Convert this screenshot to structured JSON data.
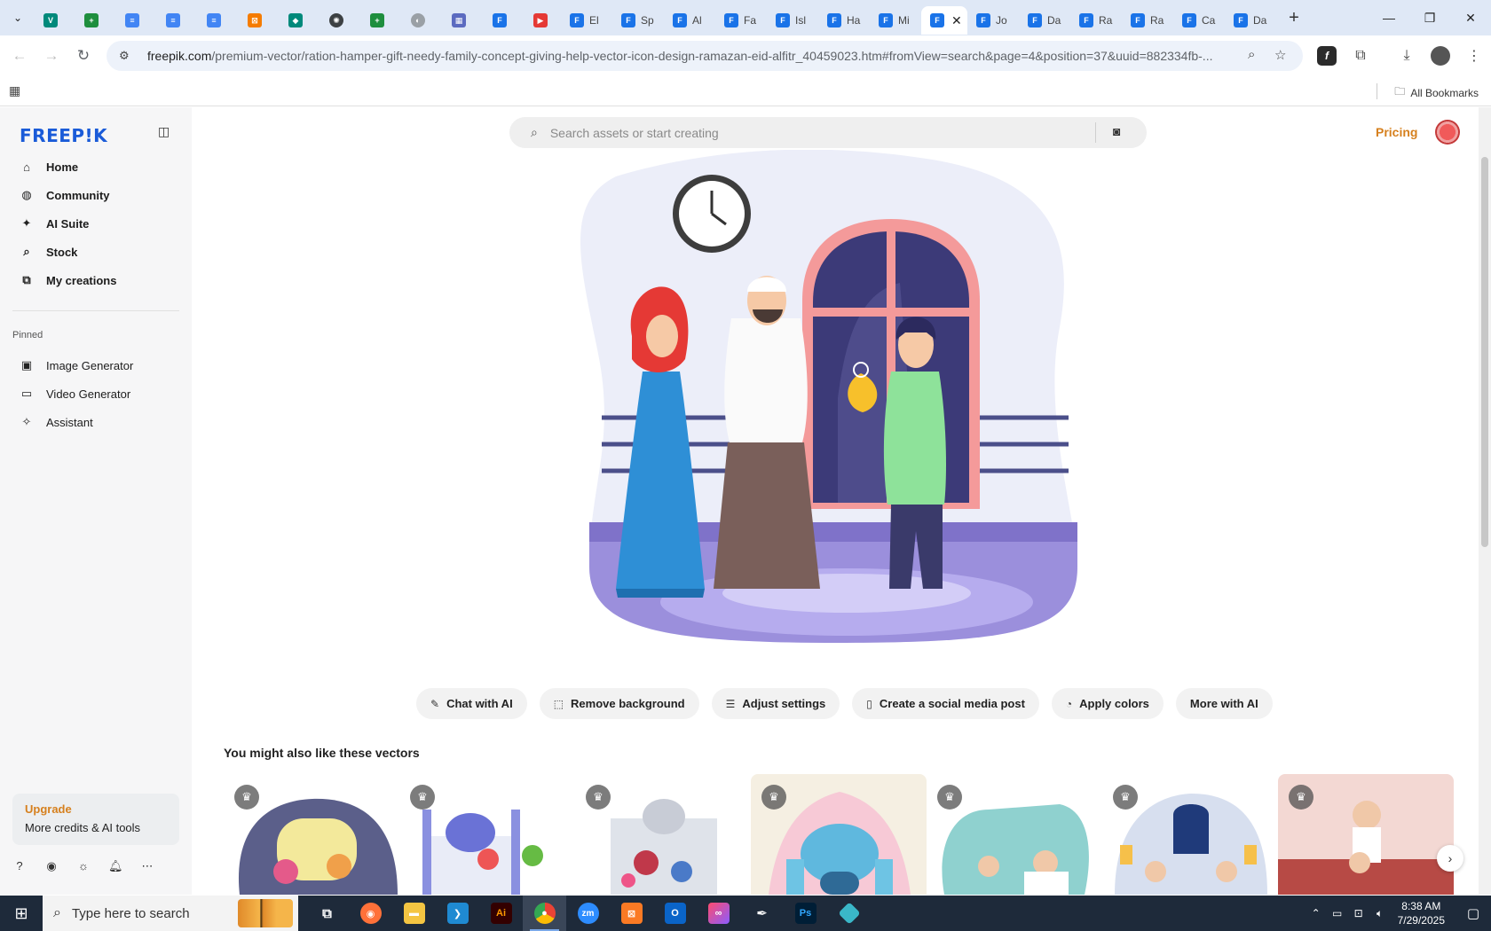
{
  "browser": {
    "tabs": [
      {
        "icon": "chevron-down-icon",
        "pinned": true
      },
      {
        "icon": "vpn-icon",
        "pinned": true
      },
      {
        "icon": "sheets-icon",
        "pinned": true
      },
      {
        "icon": "docs-icon",
        "pinned": true
      },
      {
        "icon": "docs-icon",
        "pinned": true
      },
      {
        "icon": "docs-icon",
        "pinned": true
      },
      {
        "icon": "xampp-icon",
        "pinned": true
      },
      {
        "icon": "tech-icon",
        "pinned": true
      },
      {
        "icon": "openai-icon",
        "pinned": true
      },
      {
        "icon": "sheets-icon",
        "pinned": true
      },
      {
        "icon": "globe-icon",
        "pinned": true
      },
      {
        "icon": "calculator-icon",
        "pinned": true
      },
      {
        "icon": "freepik-icon",
        "pinned": true
      },
      {
        "icon": "youtube-icon",
        "pinned": true
      },
      {
        "icon": "freepik-icon",
        "title": "El"
      },
      {
        "icon": "freepik-icon",
        "title": "Sp"
      },
      {
        "icon": "freepik-icon",
        "title": "Al"
      },
      {
        "icon": "freepik-icon",
        "title": "Fa"
      },
      {
        "icon": "freepik-icon",
        "title": "Isl"
      },
      {
        "icon": "freepik-icon",
        "title": "Ha"
      },
      {
        "icon": "freepik-icon",
        "title": "Mi"
      },
      {
        "icon": "freepik-icon",
        "active": true
      },
      {
        "icon": "freepik-icon",
        "title": "Jo"
      },
      {
        "icon": "freepik-icon",
        "title": "Da"
      },
      {
        "icon": "freepik-icon",
        "title": "Ra"
      },
      {
        "icon": "freepik-icon",
        "title": "Ra"
      },
      {
        "icon": "freepik-icon",
        "title": "Ca"
      },
      {
        "icon": "freepik-icon",
        "title": "Da"
      }
    ],
    "url_host": "freepik.com",
    "url_path": "/premium-vector/ration-hamper-gift-needy-family-concept-giving-help-vector-icon-design-ramazan-eid-alfitr_40459023.htm#fromView=search&page=4&position=37&uuid=882334fb-...",
    "all_bookmarks": "All Bookmarks"
  },
  "sidebar": {
    "logo": "FREEP!K",
    "nav": [
      {
        "icon": "home-icon",
        "label": "Home"
      },
      {
        "icon": "globe-icon",
        "label": "Community"
      },
      {
        "icon": "sparkle-icon",
        "label": "AI Suite"
      },
      {
        "icon": "search-icon",
        "label": "Stock"
      },
      {
        "icon": "stack-icon",
        "label": "My creations"
      }
    ],
    "pinned_label": "Pinned",
    "pinned": [
      {
        "icon": "image-icon",
        "label": "Image Generator"
      },
      {
        "icon": "video-icon",
        "label": "Video Generator"
      },
      {
        "icon": "chat-sparkle-icon",
        "label": "Assistant"
      }
    ],
    "upgrade": {
      "title": "Upgrade",
      "subtitle": "More credits & AI tools"
    }
  },
  "header": {
    "search_placeholder": "Search assets or start creating",
    "pricing": "Pricing"
  },
  "ai_actions": [
    {
      "icon": "chat-edit-icon",
      "label": "Chat with AI"
    },
    {
      "icon": "remove-bg-icon",
      "label": "Remove background"
    },
    {
      "icon": "sliders-icon",
      "label": "Adjust settings"
    },
    {
      "icon": "phone-icon",
      "label": "Create a social media post"
    },
    {
      "icon": "palette-icon",
      "label": "Apply colors"
    },
    {
      "icon": "",
      "label": "More with AI"
    }
  ],
  "related": {
    "title": "You might also like these vectors",
    "items": [
      "mosque-family",
      "mosque-donation",
      "mosque-charity",
      "pink-mosque",
      "arch-greeting",
      "lantern-window",
      "quran-reading"
    ]
  },
  "taskbar": {
    "search_text": "Type here to search",
    "time": "8:38 AM",
    "date": "7/29/2025"
  },
  "colors": {
    "brand_blue": "#1a5bd8",
    "pricing_orange": "#d6801e",
    "sidebar_bg": "#f6f6f7"
  }
}
